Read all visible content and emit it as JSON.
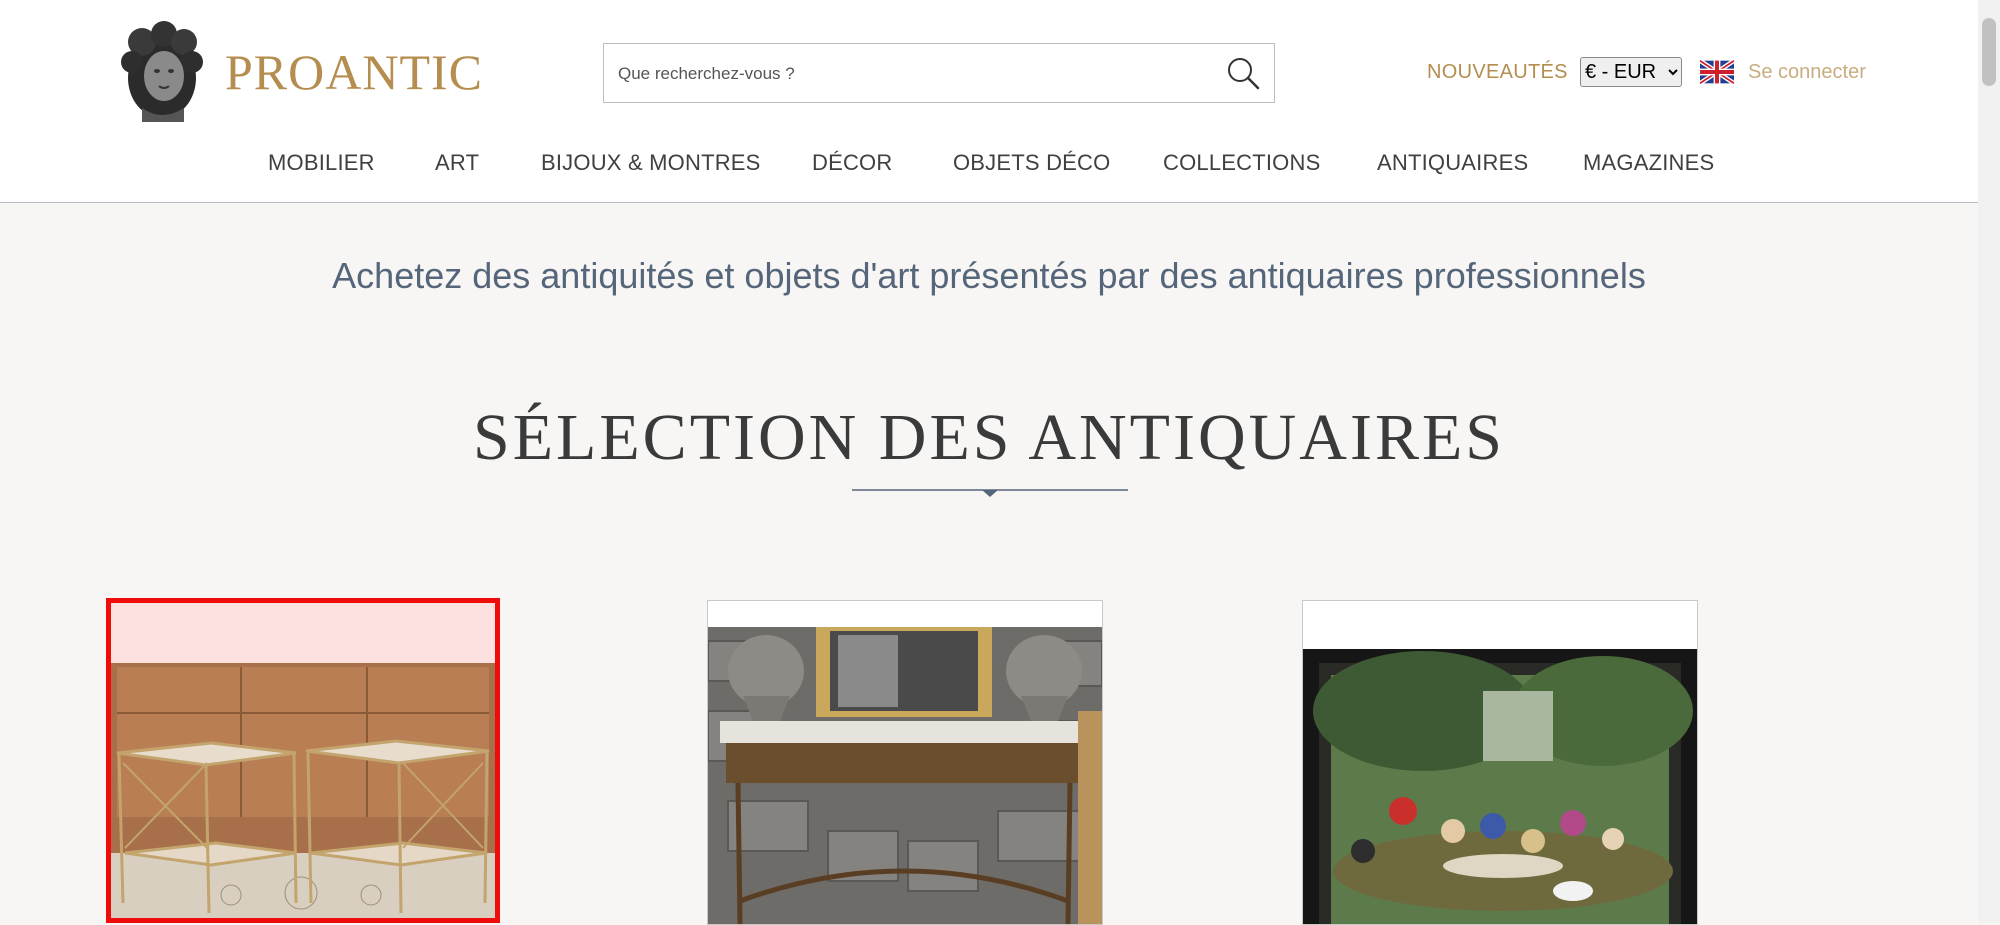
{
  "header": {
    "brand": "PROANTIC",
    "search": {
      "placeholder": "Que recherchez-vous ?",
      "value": ""
    },
    "nouveautes": "NOUVEAUTÉS",
    "currency": {
      "selected": "€ - EUR",
      "options": [
        "€ - EUR"
      ]
    },
    "login": "Se connecter"
  },
  "nav": {
    "items": [
      {
        "label": "MOBILIER"
      },
      {
        "label": "ART"
      },
      {
        "label": "BIJOUX & MONTRES"
      },
      {
        "label": "DÉCOR"
      },
      {
        "label": "OBJETS DÉCO"
      },
      {
        "label": "COLLECTIONS"
      },
      {
        "label": "ANTIQUAIRES"
      },
      {
        "label": "MAGAZINES"
      }
    ]
  },
  "main": {
    "tagline": "Achetez des antiquités et objets d'art présentés par des antiquaires professionnels",
    "section_title": "SÉLECTION DES ANTIQUAIRES"
  },
  "theme": {
    "gold": "#b48d4f",
    "gold_light": "#c8ad80",
    "selected_outline": "#f00b0b",
    "tagline_color": "#55657a"
  },
  "icons": {
    "search": "search-icon",
    "flag": "uk-flag-icon",
    "logo": "bust-logo"
  }
}
